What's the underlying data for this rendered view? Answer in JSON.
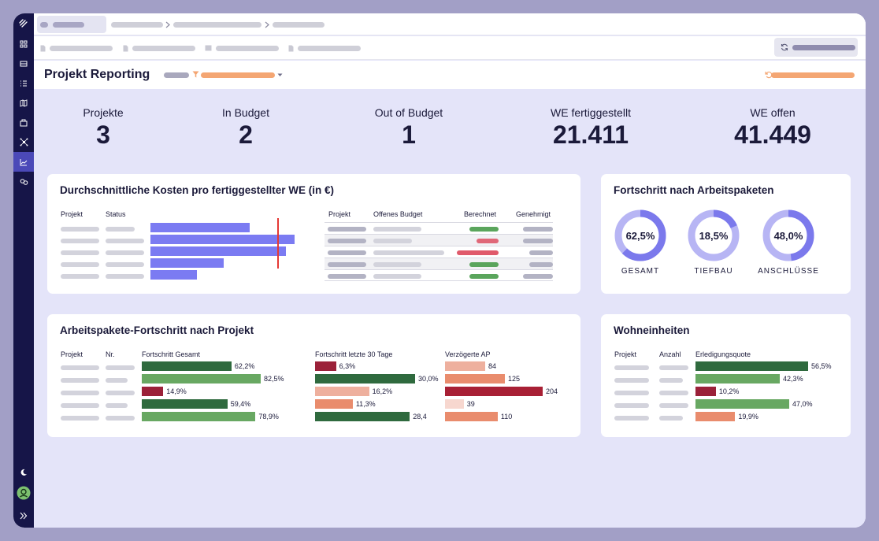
{
  "page": {
    "title": "Projekt Reporting"
  },
  "kpis": [
    {
      "label": "Projekte",
      "value": "3"
    },
    {
      "label": "In Budget",
      "value": "2"
    },
    {
      "label": "Out of Budget",
      "value": "1"
    },
    {
      "label": "WE fertiggestellt",
      "value": "21.411"
    },
    {
      "label": "WE offen",
      "value": "41.449"
    }
  ],
  "costs": {
    "title": "Durchschnittliche Kosten pro fertiggestellter WE (in €)",
    "left_headers": {
      "projekt": "Projekt",
      "status": "Status"
    },
    "right_headers": {
      "projekt": "Projekt",
      "offen": "Offenes Budget",
      "berechnet": "Berechnet",
      "genehmigt": "Genehmigt"
    },
    "bar_values": [
      0.69,
      1.0,
      0.94,
      0.51,
      0.32
    ],
    "reference_line": 0.88,
    "bar_color": "#7b7bf2",
    "line_color": "#e53935",
    "berechnet_colors": [
      "#5aa55c",
      "#e06878",
      "#e05a6b",
      "#5aa55c",
      "#5aa55c"
    ]
  },
  "fortschritt": {
    "title": "Fortschritt nach Arbeitspaketen",
    "donuts": [
      {
        "value": "62,5%",
        "fraction": 0.625,
        "label": "GESAMT"
      },
      {
        "value": "18,5%",
        "fraction": 0.185,
        "label": "TIEFBAU"
      },
      {
        "value": "48,0%",
        "fraction": 0.48,
        "label": "ANSCHLÜSSE"
      }
    ],
    "track_color": "#b7b5f4",
    "fill_color": "#7b79ec"
  },
  "ap": {
    "title": "Arbeitspakete-Fortschritt nach Projekt",
    "headers": {
      "projekt": "Projekt",
      "nr": "Nr.",
      "gesamt": "Fortschritt Gesamt",
      "letzte30": "Fortschritt letzte 30 Tage",
      "verzoegert": "Verzögerte AP"
    },
    "gesamt": [
      {
        "label": "62,2%",
        "value": 62.2,
        "color": "#2f6a3e"
      },
      {
        "label": "82,5%",
        "value": 82.5,
        "color": "#68a862"
      },
      {
        "label": "14,9%",
        "value": 14.9,
        "color": "#9b2139"
      },
      {
        "label": "59,4%",
        "value": 59.4,
        "color": "#2f6a3e"
      },
      {
        "label": "78,9%",
        "value": 78.9,
        "color": "#68a862"
      }
    ],
    "letzte30": [
      {
        "label": "6,3%",
        "value": 6.3,
        "color": "#9b2139"
      },
      {
        "label": "30,0%",
        "value": 30.0,
        "color": "#2f6a3e"
      },
      {
        "label": "16,2%",
        "value": 16.2,
        "color": "#eeb09e"
      },
      {
        "label": "11,3%",
        "value": 11.3,
        "color": "#e98c6d"
      },
      {
        "label": "28,4",
        "value": 28.4,
        "color": "#2f6a3e"
      }
    ],
    "verzoegert": [
      {
        "label": "84",
        "value": 84,
        "color": "#eeb09e"
      },
      {
        "label": "125",
        "value": 125,
        "color": "#e98c6d"
      },
      {
        "label": "204",
        "value": 204,
        "color": "#a82035"
      },
      {
        "label": "39",
        "value": 39,
        "color": "#f7d7cf"
      },
      {
        "label": "110",
        "value": 110,
        "color": "#e98c6d"
      }
    ]
  },
  "we": {
    "title": "Wohneinheiten",
    "headers": {
      "projekt": "Projekt",
      "anzahl": "Anzahl",
      "quote": "Erledigungsquote"
    },
    "rows": [
      {
        "label": "56,5%",
        "value": 56.5,
        "color": "#2f6a3e"
      },
      {
        "label": "42,3%",
        "value": 42.3,
        "color": "#68a862"
      },
      {
        "label": "10,2%",
        "value": 10.2,
        "color": "#9b2139"
      },
      {
        "label": "47,0%",
        "value": 47.0,
        "color": "#68a862"
      },
      {
        "label": "19,9%",
        "value": 19.9,
        "color": "#e98c6d"
      }
    ]
  }
}
